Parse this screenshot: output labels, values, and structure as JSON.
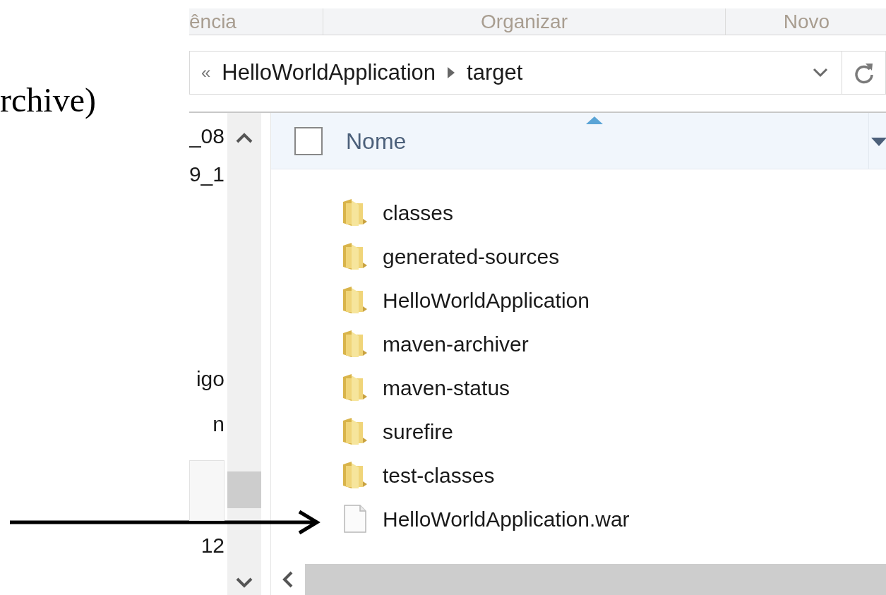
{
  "document_text": "rchive)",
  "ribbon_groups": [
    {
      "label": "ência"
    },
    {
      "label": "Organizar"
    },
    {
      "label": "Novo"
    }
  ],
  "address_bar": {
    "overflow": "«",
    "path": [
      "HelloWorldApplication",
      "target"
    ]
  },
  "navigation_pane": {
    "items": [
      {
        "label": "_08",
        "selected": false
      },
      {
        "label": "9_1",
        "selected": false
      },
      {
        "label": "igo",
        "selected": false
      },
      {
        "label": "n",
        "selected": false
      },
      {
        "selected": true
      },
      {
        "label": "12",
        "selected": false
      }
    ]
  },
  "column_header": {
    "label": "Nome",
    "checked": false
  },
  "files": [
    {
      "name": "classes",
      "kind": "folder"
    },
    {
      "name": "generated-sources",
      "kind": "folder"
    },
    {
      "name": "HelloWorldApplication",
      "kind": "folder"
    },
    {
      "name": "maven-archiver",
      "kind": "folder"
    },
    {
      "name": "maven-status",
      "kind": "folder"
    },
    {
      "name": "surefire",
      "kind": "folder"
    },
    {
      "name": "test-classes",
      "kind": "folder"
    },
    {
      "name": "HelloWorldApplication.war",
      "kind": "file"
    }
  ]
}
